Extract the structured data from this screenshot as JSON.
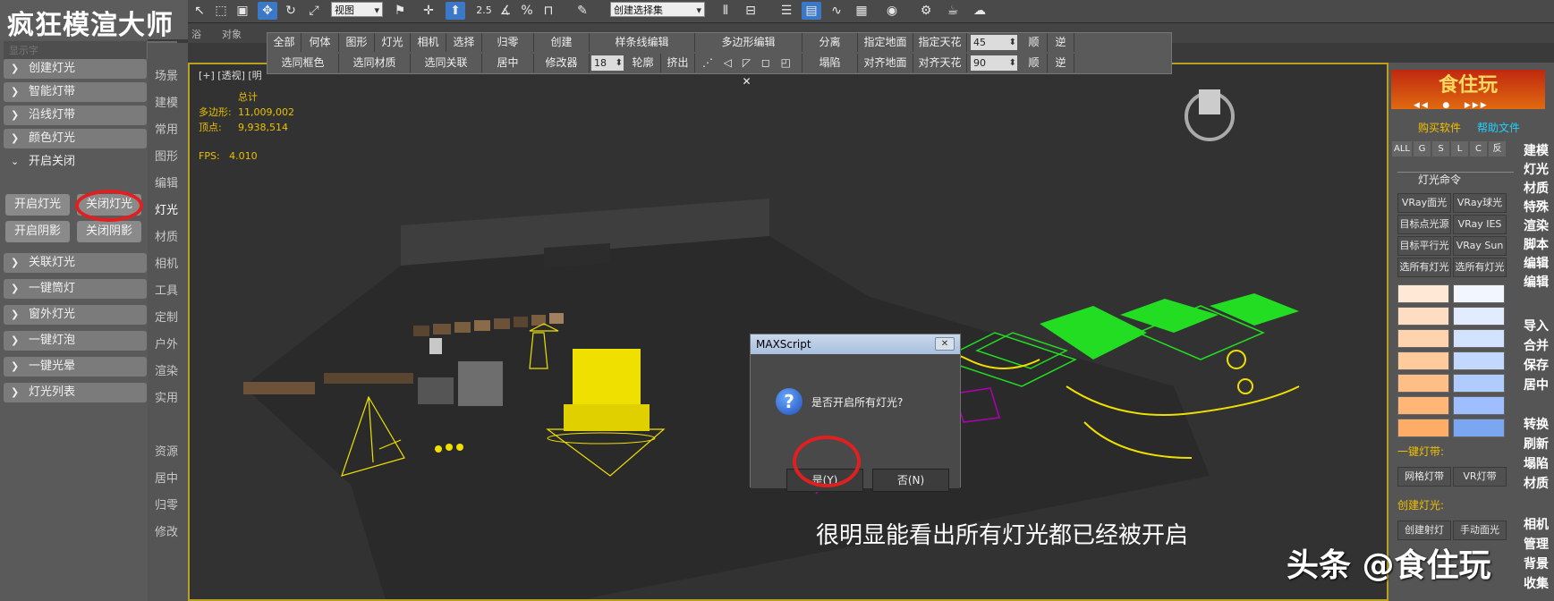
{
  "app": {
    "logo_text": "疯狂模渲大师",
    "search_placeholder": "显示字",
    "viewport_label": "[+] [透视] [明"
  },
  "left_panel": {
    "items": [
      {
        "label": "创建灯光"
      },
      {
        "label": "智能灯带"
      },
      {
        "label": "沿线灯带"
      },
      {
        "label": "颜色灯光"
      },
      {
        "label": "开启关闭"
      },
      {
        "label": "关联灯光"
      },
      {
        "label": "一键筒灯"
      },
      {
        "label": "窗外灯光"
      },
      {
        "label": "一键灯泡"
      },
      {
        "label": "一键光晕"
      },
      {
        "label": "灯光列表"
      }
    ],
    "buttons": {
      "lights_on": "开启灯光",
      "lights_off": "关闭灯光",
      "shadows_on": "开启阴影",
      "shadows_off": "关闭阴影"
    }
  },
  "categories": {
    "top": [
      "场景",
      "建模",
      "常用",
      "图形",
      "编辑",
      "灯光",
      "材质",
      "相机",
      "工具",
      "定制",
      "户外",
      "渲染",
      "实用"
    ],
    "bottom": [
      "资源",
      "居中",
      "归零",
      "修改"
    ]
  },
  "toolbar": {
    "view_select": "视图",
    "selection_set": "创建选择集",
    "snap_value": "2.5",
    "percent_label": "%",
    "menu2_left": "浴",
    "menu2_obj": "对象"
  },
  "float_toolbar": {
    "row1": [
      "全部",
      "何体",
      "图形",
      "灯光",
      "相机",
      "选择",
      "归零",
      "创建",
      "样条线编辑",
      "多边形编辑",
      "分离",
      "指定地面",
      "指定天花",
      "顺",
      "逆"
    ],
    "row2": [
      "选同框色",
      "选同材质",
      "选同关联",
      "居中",
      "修改器",
      "轮廓",
      "挤出",
      "塌陷",
      "对齐地面",
      "对齐天花",
      "顺",
      "逆"
    ],
    "spinner_top": "45",
    "spinner_bottom": "90",
    "spinner_outline": "18"
  },
  "stats": {
    "header": "总计",
    "polys_label": "多边形:",
    "polys": "11,009,002",
    "verts_label": "顶点:",
    "verts": "9,938,514",
    "fps_label": "FPS:",
    "fps": "4.010"
  },
  "dialog": {
    "title": "MAXScript",
    "close_label": "✕",
    "message": "是否开启所有灯光?",
    "yes": "是(Y)",
    "no": "否(N)"
  },
  "right_panel": {
    "brand": "食住玩",
    "brand_small": "食住玩",
    "buy": "购买软件",
    "help": "帮助文件",
    "tabs": [
      "ALL",
      "G",
      "S",
      "L",
      "C",
      "反"
    ],
    "light_cmd_title": "灯光命令",
    "light_buttons": [
      "VRay面光",
      "VRay球光",
      "目标点光源",
      "VRay IES",
      "目标平行光",
      "VRay Sun",
      "选所有灯光",
      "选所有灯光"
    ],
    "swatches_left": [
      "#ffe8d6",
      "#ffddc2",
      "#ffd3ae",
      "#ffca9c",
      "#ffbe86",
      "#ffb676",
      "#ffad66"
    ],
    "swatches_right": [
      "#f2f6ff",
      "#e2ecff",
      "#d2e2ff",
      "#c2d8ff",
      "#b0ccff",
      "#9ebeff",
      "#7aa6f2"
    ],
    "strip_title": "一键灯带:",
    "strip_buttons": [
      "网格灯带",
      "VR灯带"
    ],
    "create_title": "创建灯光:",
    "create_buttons": [
      "创建射灯",
      "手动面光"
    ],
    "side_labels_1": [
      "建模",
      "灯光",
      "材质",
      "特殊",
      "渲染",
      "脚本",
      "编辑",
      "编辑"
    ],
    "side_labels_2": [
      "导入",
      "合并",
      "保存",
      "居中"
    ],
    "side_labels_3": [
      "转换",
      "刷新",
      "塌陷",
      "材质"
    ],
    "side_labels_4": [
      "相机",
      "管理",
      "背景",
      "收集"
    ]
  },
  "caption": "很明显能看出所有灯光都已经被开启",
  "watermark": "头条 @食住玩",
  "colors": {
    "viewport_border": "#b8a020",
    "highlight_red": "#e02020",
    "stats_yellow": "#e8c000",
    "light_green": "#22dd22"
  }
}
